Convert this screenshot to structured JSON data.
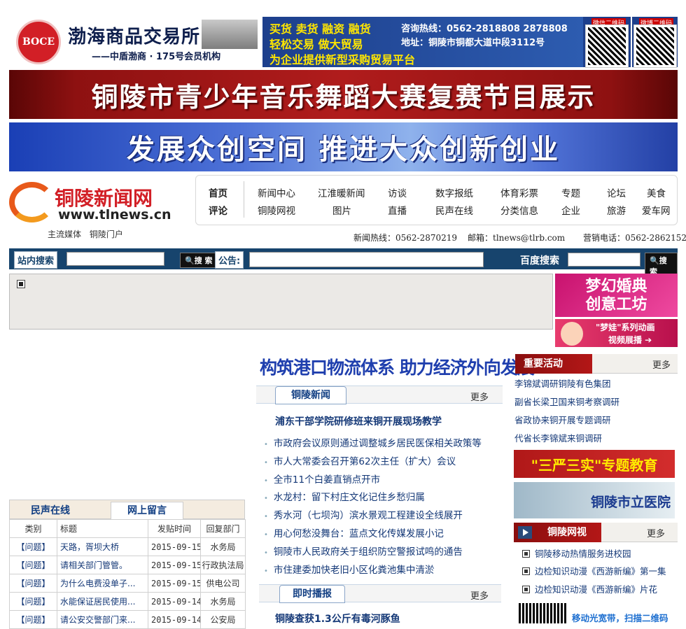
{
  "top_ad": {
    "logo_text": "BOCE",
    "name": "渤海商品交易所",
    "sub": "——中盾渤商 · 175号会员机构",
    "slogan_1": "买货 卖货 融资 融货",
    "slogan_2": "轻松交易  做大贸易",
    "slogan_3": "为企业提供新型采购贸易平台",
    "hotline": "咨询热线：0562-2818808  2878808",
    "address": "地址：铜陵市铜都大道中段3112号",
    "qr1_label": "微信二维码",
    "qr2_label": "微博二维码"
  },
  "banner1": "铜陵市青少年音乐舞蹈大赛复赛节目展示",
  "banner2": "发展众创空间  推进大众创新创业",
  "logo": {
    "cn": "铜陵新闻网",
    "url": "www.tlnews.cn",
    "slogan": "主流媒体  铜陵门户"
  },
  "nav": {
    "home": "首页",
    "comment": "评论",
    "row1": [
      "新闻中心",
      "江淮暖新闻",
      "访谈",
      "数字报纸",
      "体育彩票",
      "专题",
      "论坛",
      "美食"
    ],
    "row2": [
      "铜陵网视",
      "图片",
      "直播",
      "民声在线",
      "分类信息",
      "企业",
      "旅游",
      "爱车网"
    ]
  },
  "hotlines": {
    "news": "新闻热线：0562-2870219",
    "email": "邮箱：tlnews@tlrb.com",
    "sales": "营销电话：0562-2862152"
  },
  "search": {
    "site_label": "站内搜索",
    "go": "搜 索",
    "notice": "公告:",
    "baidu": "百度搜索"
  },
  "ads": {
    "wedding": "梦幻婚典\n创意工坊",
    "meng_1": "\"梦娃\"系列动画",
    "meng_2": "视频展播 ➔"
  },
  "headline": "构筑港口物流体系  助力经济外向发展",
  "tongling_news": {
    "tab": "铜陵新闻",
    "more": "更多",
    "lead": "浦东干部学院研修班来铜开展现场教学",
    "items": [
      "市政府会议原则通过调整城乡居民医保相关政策等",
      "市人大常委会召开第62次主任（扩大）会议",
      "全市11个白姜直销点开市",
      "水龙村：留下村庄文化记住乡愁归属",
      "秀水河（七坝沟）滨水景观工程建设全线展开",
      "用心何愁没舞台：蓝点文化传媒发展小记",
      "铜陵市人民政府关于组织防空警报试鸣的通告",
      "市住建委加快老旧小区化粪池集中清淤"
    ]
  },
  "instant": {
    "tab": "即时播报",
    "more": "更多",
    "lead": "铜陵查获1.3公斤有毒河豚鱼"
  },
  "key_events": {
    "title": "重要活动",
    "more": "更多",
    "items": [
      "李锦斌调研铜陵有色集团",
      "副省长梁卫国来铜考察调研",
      "省政协来铜开展专题调研",
      "代省长李锦斌来铜调研"
    ]
  },
  "sanyan": "\"三严三实\"专题教育",
  "hospital": "铜陵市立医院",
  "tv": {
    "title": "铜陵网视",
    "more": "更多",
    "items": [
      "铜陵移动热情服务进校园",
      "边检知识动漫《西游新编》第一集",
      "边检知识动漫《西游新编》片花"
    ]
  },
  "mobile": "移动光宽带，扫描二维码",
  "voice": {
    "tab1": "民声在线",
    "tab2": "网上留言",
    "headers": [
      "类别",
      "标题",
      "发贴时间",
      "回复部门"
    ],
    "rows": [
      [
        "【问题】",
        "天路，胥坝大桥",
        "2015-09-15",
        "水务局"
      ],
      [
        "【问题】",
        "请相关部门管管。",
        "2015-09-15",
        "行政执法局"
      ],
      [
        "【问题】",
        "为什么电费没单子...",
        "2015-09-15",
        "供电公司"
      ],
      [
        "【问题】",
        "水能保证居民使用...",
        "2015-09-14",
        "水务局"
      ],
      [
        "【问题】",
        "请公安交警部门来...",
        "2015-09-14",
        "公安局"
      ]
    ]
  },
  "colors": {
    "accent_blue": "#143877",
    "brand_red": "#d21f26",
    "search_bar": "#17446d"
  }
}
